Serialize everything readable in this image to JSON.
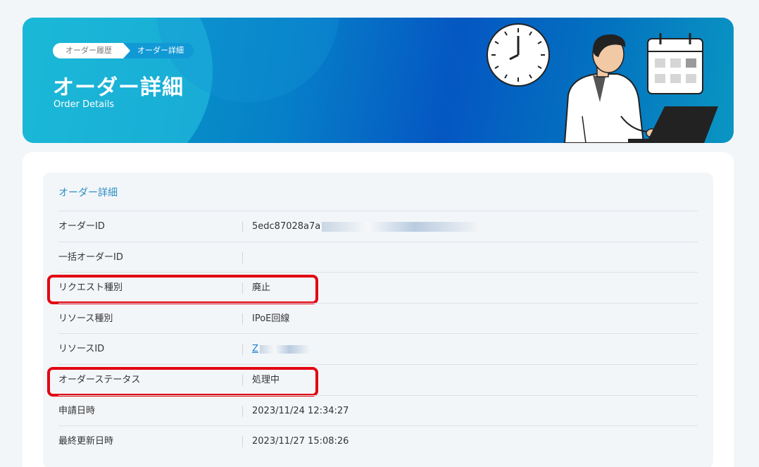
{
  "breadcrumb": {
    "items": [
      "オーダー履歴",
      "オーダー詳細"
    ]
  },
  "header": {
    "title": "オーダー詳細",
    "subtitle": "Order Details"
  },
  "panel": {
    "title": "オーダー詳細",
    "rows": [
      {
        "label": "オーダーID",
        "value": "5edc87028a7a"
      },
      {
        "label": "一括オーダーID",
        "value": ""
      },
      {
        "label": "リクエスト種別",
        "value": "廃止"
      },
      {
        "label": "リソース種別",
        "value": "IPoE回線"
      },
      {
        "label": "リソースID",
        "value": "Z"
      },
      {
        "label": "オーダーステータス",
        "value": "処理中"
      },
      {
        "label": "申請日時",
        "value": "2023/11/24 12:34:27"
      },
      {
        "label": "最終更新日時",
        "value": "2023/11/27 15:08:26"
      }
    ]
  },
  "colors": {
    "accent": "#2c8fc6",
    "highlight": "#e30613",
    "banner": "#0557c2"
  }
}
